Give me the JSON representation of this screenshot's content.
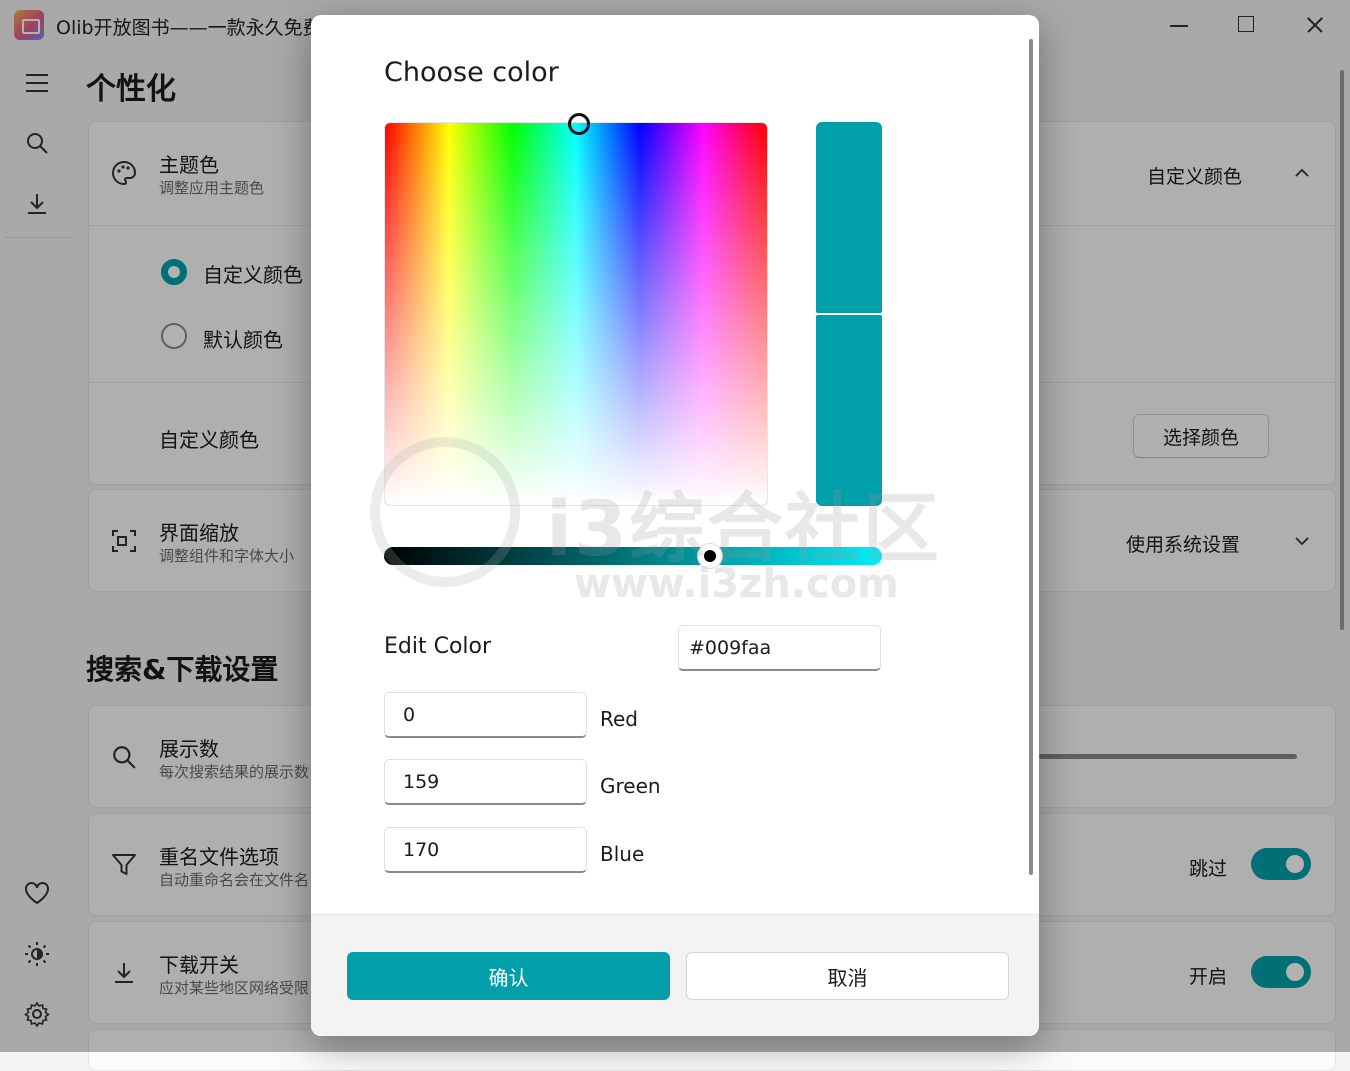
{
  "window": {
    "title": "Olib开放图书——一款永久免费"
  },
  "page": {
    "title": "个性化",
    "section2_title": "搜索&下载设置"
  },
  "theme_card": {
    "title": "主题色",
    "subtitle": "调整应用主题色",
    "value": "自定义颜色",
    "options": [
      {
        "label": "自定义颜色",
        "selected": true
      },
      {
        "label": "默认颜色",
        "selected": false
      }
    ],
    "custom_label": "自定义颜色",
    "choose_button": "选择颜色"
  },
  "scale_card": {
    "title": "界面缩放",
    "subtitle": "调整组件和字体大小",
    "value": "使用系统设置"
  },
  "count_card": {
    "title": "展示数",
    "subtitle": "每次搜索结果的展示数"
  },
  "rename_card": {
    "title": "重名文件选项",
    "subtitle": "自动重命名会在文件名",
    "value": "跳过"
  },
  "download_card": {
    "title": "下载开关",
    "subtitle": "应对某些地区网络受限",
    "value": "开启"
  },
  "dialog": {
    "title": "Choose color",
    "edit_label": "Edit Color",
    "hex": "#009faa",
    "red": "0",
    "green": "159",
    "blue": "170",
    "red_label": "Red",
    "green_label": "Green",
    "blue_label": "Blue",
    "confirm": "确认",
    "cancel": "取消",
    "value_fraction": 0.655
  },
  "watermark": {
    "text": "i3综合社区",
    "url": "www.i3zh.com"
  },
  "colors": {
    "accent": "#009faa",
    "background": "#f3f3f3"
  }
}
